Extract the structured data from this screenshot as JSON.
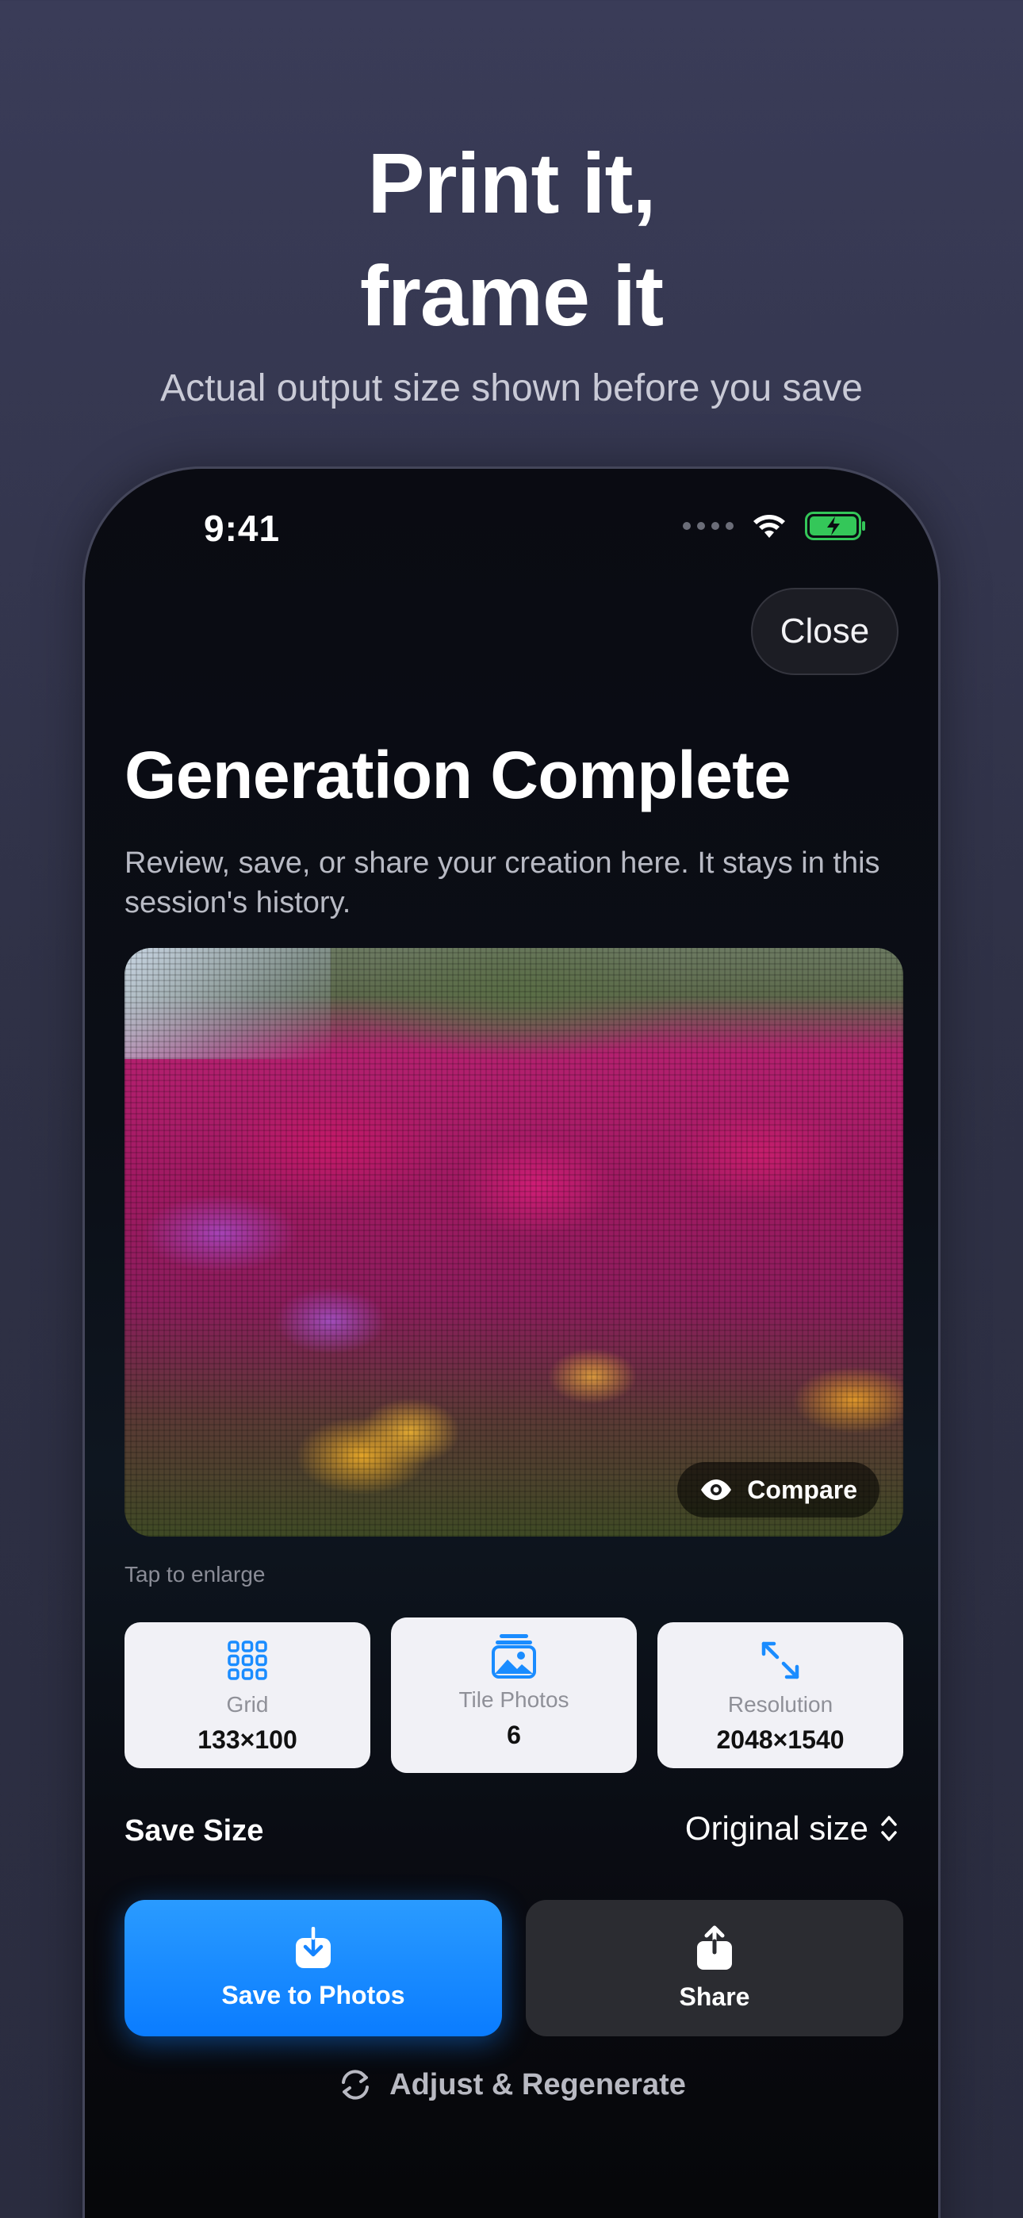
{
  "marketing": {
    "headline_line1": "Print it,",
    "headline_line2": "frame it",
    "subheadline": "Actual output size shown before you save"
  },
  "status_bar": {
    "time": "9:41"
  },
  "sheet": {
    "close_label": "Close",
    "title": "Generation Complete",
    "description": "Review, save, or share your creation here. It stays in this session's history.",
    "compare_label": "Compare",
    "tap_hint": "Tap to enlarge"
  },
  "stats": [
    {
      "icon": "grid-icon",
      "label": "Grid",
      "value": "133×100"
    },
    {
      "icon": "photos-icon",
      "label": "Tile Photos",
      "value": "6"
    },
    {
      "icon": "expand-icon",
      "label": "Resolution",
      "value": "2048×1540"
    }
  ],
  "save_size": {
    "label": "Save Size",
    "selected": "Original size"
  },
  "actions": {
    "save_label": "Save to Photos",
    "share_label": "Share",
    "regenerate_label": "Adjust & Regenerate"
  },
  "colors": {
    "accent": "#0a7cff",
    "battery": "#34c759"
  }
}
